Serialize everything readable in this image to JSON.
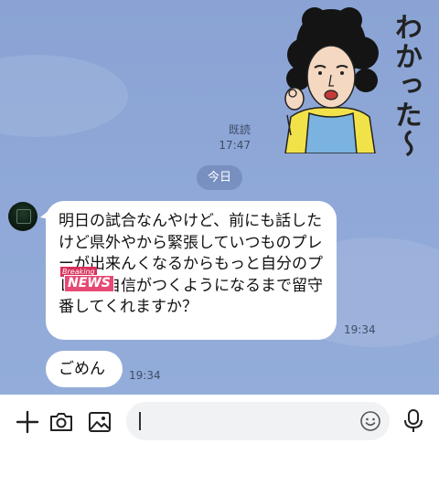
{
  "sticker": {
    "caption": "わかった〜"
  },
  "outgoing": {
    "read_label": "既読",
    "time": "17:47"
  },
  "date_separator": "今日",
  "messages": [
    {
      "text": "明日の試合なんやけど、前にも話したけど県外やから緊張していつものプレーが出来んくなるからもっと自分のプレーに自信がつくようになるまで留守番してくれますか？",
      "time": "19:34"
    },
    {
      "text": "ごめん",
      "time": "19:34"
    }
  ],
  "news_badge": {
    "top": "Breaking",
    "main": "NEWS"
  },
  "input": {
    "placeholder": ""
  },
  "colors": {
    "chat_background": "#8fa8d7",
    "bubble": "#ffffff",
    "apron": "#7bb3e0",
    "shirt": "#f2e24a"
  },
  "icons": [
    "plus-icon",
    "camera-icon",
    "image-icon",
    "emoji-icon",
    "microphone-icon"
  ]
}
